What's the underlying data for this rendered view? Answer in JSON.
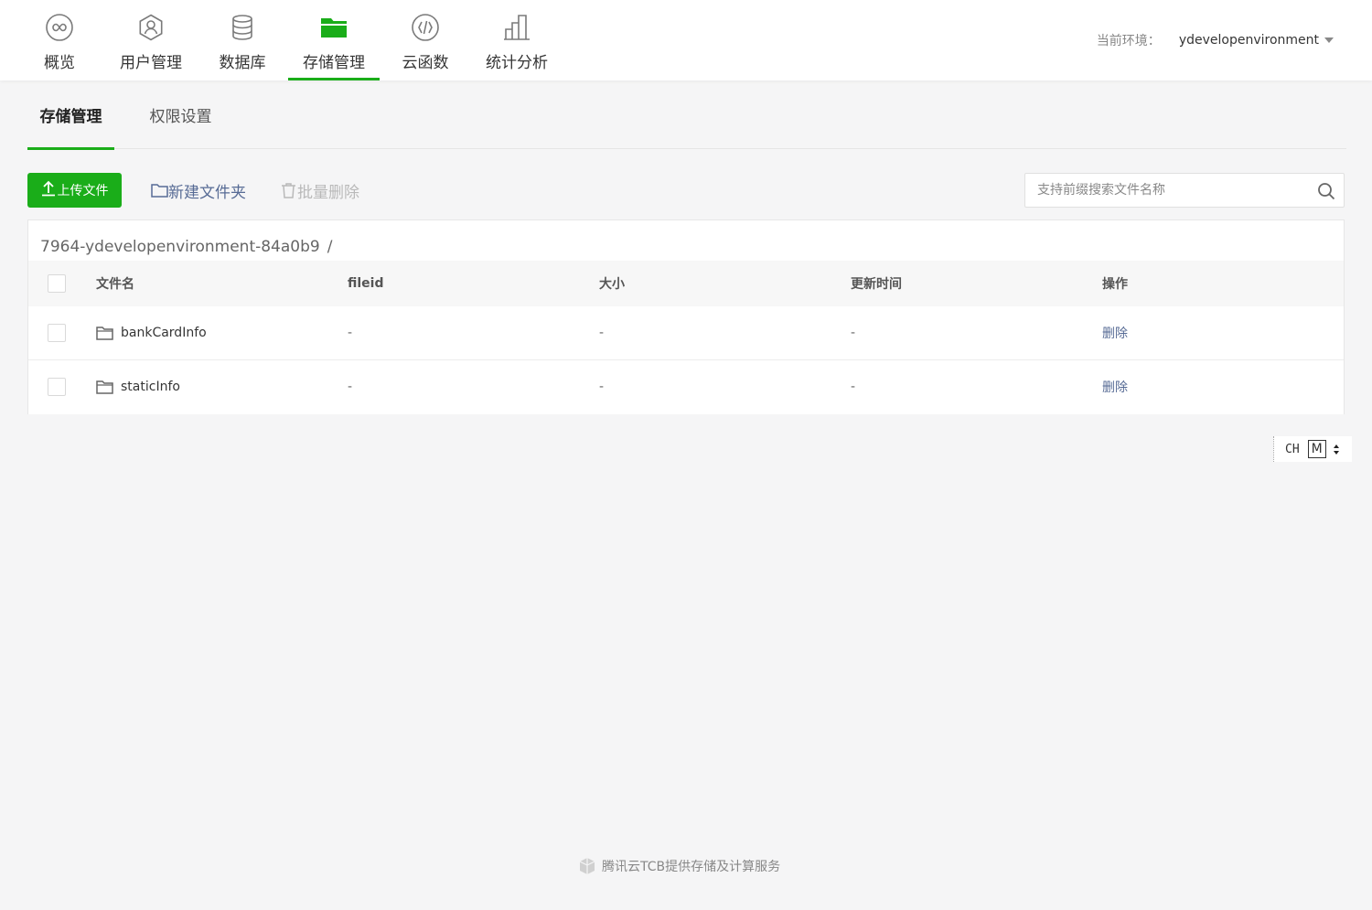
{
  "nav": {
    "items": [
      {
        "label": "概览",
        "icon": "infinity-icon"
      },
      {
        "label": "用户管理",
        "icon": "user-icon"
      },
      {
        "label": "数据库",
        "icon": "database-icon"
      },
      {
        "label": "存储管理",
        "icon": "folder-icon"
      },
      {
        "label": "云函数",
        "icon": "code-icon"
      },
      {
        "label": "统计分析",
        "icon": "bar-chart-icon"
      }
    ],
    "active_index": 3
  },
  "env": {
    "label": "当前环境：",
    "value": "ydevelopenvironment"
  },
  "subtabs": {
    "storage": "存储管理",
    "permissions": "权限设置",
    "active": "storage"
  },
  "toolbar": {
    "upload_label": "上传文件",
    "new_folder_label": "新建文件夹",
    "batch_delete_label": "批量删除",
    "search_placeholder": "支持前缀搜索文件名称",
    "search_value": ""
  },
  "table": {
    "breadcrumb": "7964-ydevelopenvironment-84a0b9",
    "breadcrumb_sep": "/",
    "columns": {
      "name": "文件名",
      "fileid": "fileid",
      "size": "大小",
      "updated": "更新时间",
      "actions": "操作"
    },
    "rows": [
      {
        "name": "bankCardInfo",
        "fileid": "-",
        "size": "-",
        "updated": "-",
        "action": "删除"
      },
      {
        "name": "staticInfo",
        "fileid": "-",
        "size": "-",
        "updated": "-",
        "action": "删除"
      }
    ]
  },
  "ime": {
    "lang": "CH",
    "mode": "M"
  },
  "footer": {
    "text": "腾讯云TCB提供存储及计算服务"
  },
  "colors": {
    "accent": "#1aad19",
    "link": "#576b95",
    "disabled": "#b9b9b9",
    "background": "#f5f5f6"
  }
}
